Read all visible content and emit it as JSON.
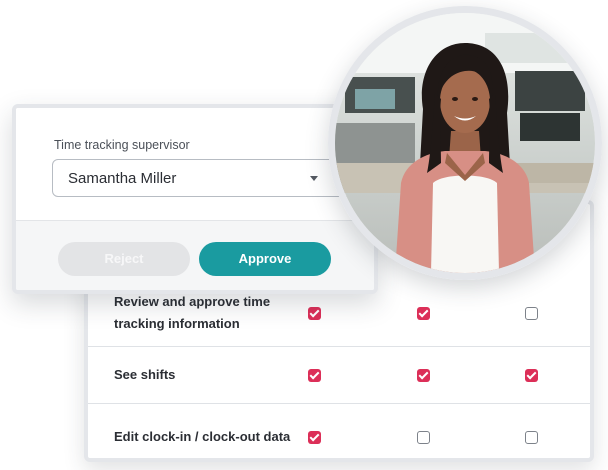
{
  "approval": {
    "field_label": "Time tracking supervisor",
    "selected_supervisor": "Samantha Miller",
    "reject_label": "Reject",
    "approve_label": "Approve"
  },
  "permissions": {
    "rows": [
      {
        "label": "Review and approve time tracking information",
        "checks": [
          true,
          true,
          false
        ]
      },
      {
        "label": "See shifts",
        "checks": [
          true,
          true,
          true
        ]
      },
      {
        "label": "Edit clock-in / clock-out data",
        "checks": [
          true,
          false,
          false
        ]
      }
    ]
  },
  "colors": {
    "accent": "#1a9ba0",
    "checkbox_checked": "#dc2f58",
    "card_border": "#e4e6ea"
  }
}
